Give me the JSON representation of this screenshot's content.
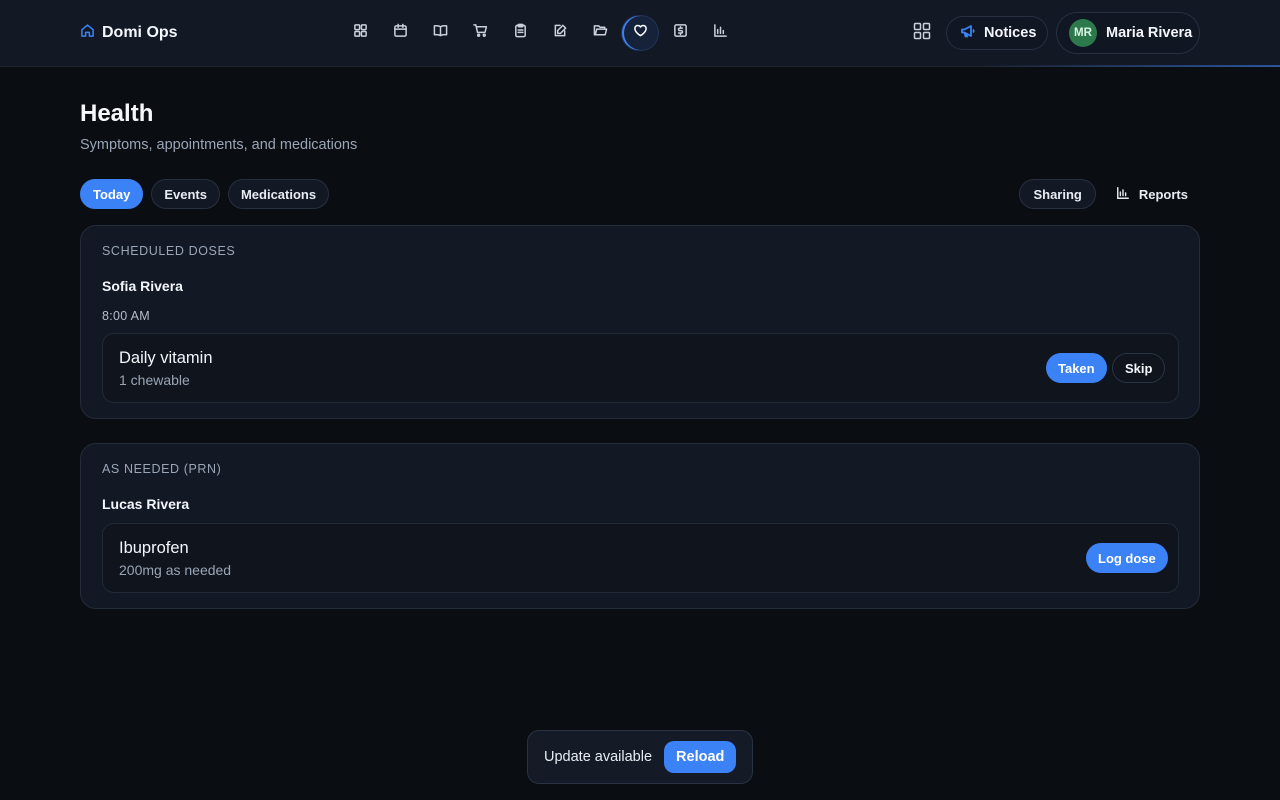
{
  "app": {
    "brand": "Domi Ops",
    "brand_icon": "home-icon",
    "accent": "#3b82f6"
  },
  "nav": {
    "icons": [
      "dashboard-icon",
      "calendar-icon",
      "book-icon",
      "cart-icon",
      "clipboard-icon",
      "note-edit-icon",
      "folder-icon",
      "heart-icon",
      "dollar-icon",
      "bar-chart-icon"
    ],
    "active": "heart-icon"
  },
  "header": {
    "apps_icon": "apps-grid-icon",
    "notices_label": "Notices",
    "notices_icon": "megaphone-icon",
    "user": {
      "initials": "MR",
      "name": "Maria Rivera",
      "avatar_color": "#2c7a4b"
    }
  },
  "page": {
    "title": "Health",
    "subtitle": "Symptoms, appointments, and medications"
  },
  "tabs": [
    {
      "label": "Today",
      "active": true
    },
    {
      "label": "Events",
      "active": false
    },
    {
      "label": "Medications",
      "active": false
    }
  ],
  "actions": {
    "sharing_label": "Sharing",
    "reports_label": "Reports"
  },
  "scheduled": {
    "section_label": "SCHEDULED DOSES",
    "person": "Sofia Rivera",
    "time": "8:00 AM",
    "med": {
      "name": "Daily vitamin",
      "dose": "1 chewable"
    },
    "taken_label": "Taken",
    "skip_label": "Skip"
  },
  "prn": {
    "section_label": "AS NEEDED (PRN)",
    "person": "Lucas Rivera",
    "med": {
      "name": "Ibuprofen",
      "dose": "200mg as needed"
    },
    "log_label": "Log dose"
  },
  "toast": {
    "text": "Update available",
    "reload_label": "Reload"
  }
}
